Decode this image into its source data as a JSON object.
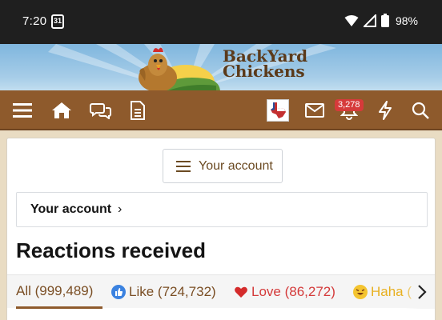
{
  "status_bar": {
    "time": "7:20",
    "calendar_day": "31",
    "battery": "98%"
  },
  "banner": {
    "logo_line1": "BackYard",
    "logo_line2": "Chickens"
  },
  "nav": {
    "alerts_count": "3,278",
    "icons": [
      "menu-icon",
      "home-icon",
      "chat-icon",
      "document-icon",
      "avatar",
      "mail-icon",
      "bell-icon",
      "bolt-icon",
      "search-icon"
    ]
  },
  "account_button": {
    "label": "Your account"
  },
  "breadcrumb": {
    "label": "Your account",
    "chevron": "›"
  },
  "page": {
    "title": "Reactions received"
  },
  "tabs": [
    {
      "label": "All (999,489)",
      "active": true
    },
    {
      "label": "Like (724,732)",
      "icon": "like-icon"
    },
    {
      "label": "Love (86,272)",
      "icon": "love-icon"
    },
    {
      "label": "Haha (",
      "icon": "haha-icon"
    }
  ],
  "colors": {
    "nav_brown": "#8e5a2c",
    "status_dark": "#1f1f1f",
    "like_blue": "#3b82e0",
    "love_red": "#d43a3a",
    "haha_yellow": "#e8b020"
  }
}
